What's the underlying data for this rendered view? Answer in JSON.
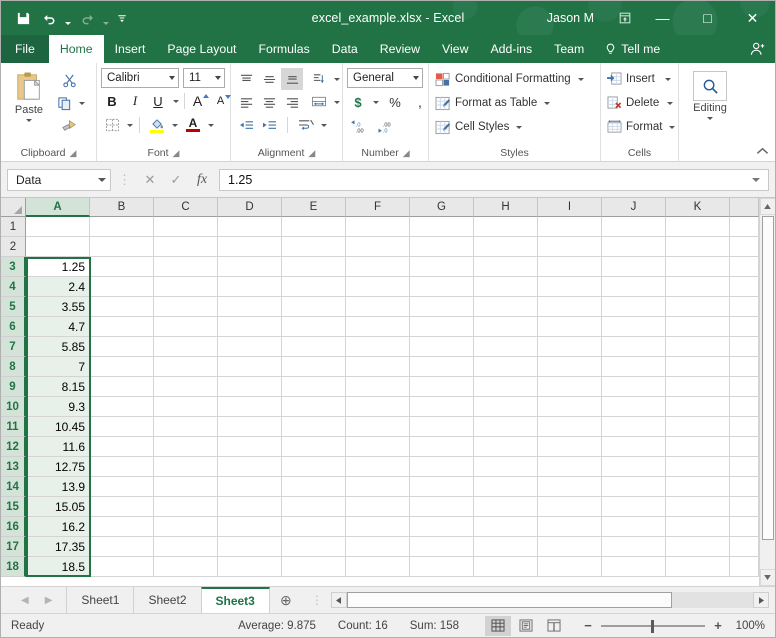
{
  "titlebar": {
    "document_title": "excel_example.xlsx  -  Excel",
    "user_name": "Jason M",
    "qat": [
      {
        "name": "save",
        "glyph": "💾",
        "label": "Save"
      },
      {
        "name": "undo",
        "glyph": "↶",
        "label": "Undo"
      },
      {
        "name": "redo",
        "glyph": "↷",
        "label": "Redo"
      },
      {
        "name": "customize",
        "glyph": "⩛",
        "label": "Customize Quick Access Toolbar"
      }
    ],
    "ribbon_display_options": "⤒",
    "minimize": "—",
    "maximize": "□",
    "close": "✕"
  },
  "tabs": [
    {
      "label": "File",
      "active": false
    },
    {
      "label": "Home",
      "active": true
    },
    {
      "label": "Insert",
      "active": false
    },
    {
      "label": "Page Layout",
      "active": false
    },
    {
      "label": "Formulas",
      "active": false
    },
    {
      "label": "Data",
      "active": false
    },
    {
      "label": "Review",
      "active": false
    },
    {
      "label": "View",
      "active": false
    },
    {
      "label": "Add-ins",
      "active": false
    },
    {
      "label": "Team",
      "active": false
    }
  ],
  "tell_me": "Tell me",
  "ribbon": {
    "clipboard": {
      "group_label": "Clipboard",
      "paste_label": "Paste",
      "cut_label": "Cut",
      "copy_label": "Copy",
      "format_painter_label": "Format Painter"
    },
    "font": {
      "group_label": "Font",
      "font_name": "Calibri",
      "font_size": "11",
      "bold": "B",
      "italic": "I",
      "underline": "U",
      "grow_font": "A",
      "shrink_font": "A",
      "borders_label": "Borders",
      "fill_color_label": "Fill Color",
      "font_color_label": "Font Color"
    },
    "alignment": {
      "group_label": "Alignment",
      "top_align": "Top Align",
      "middle_align": "Middle Align",
      "bottom_align": "Bottom Align",
      "orientation": "Orientation",
      "align_left": "Align Left",
      "center": "Center",
      "align_right": "Align Right",
      "merge_center": "Merge & Center",
      "decrease_indent": "Decrease Indent",
      "increase_indent": "Increase Indent",
      "wrap_text": "Wrap Text"
    },
    "number": {
      "group_label": "Number",
      "format": "General",
      "accounting": "$",
      "percent": "%",
      "comma": ",",
      "increase_decimal": "Increase Decimal",
      "decrease_decimal": "Decrease Decimal"
    },
    "styles": {
      "group_label": "Styles",
      "conditional_formatting": "Conditional Formatting",
      "format_as_table": "Format as Table",
      "cell_styles": "Cell Styles"
    },
    "cells": {
      "group_label": "Cells",
      "insert": "Insert",
      "delete": "Delete",
      "format": "Format"
    },
    "editing": {
      "group_label": "",
      "label": "Editing"
    },
    "collapse": "⌃"
  },
  "formula_bar": {
    "name_box": "Data",
    "cancel_icon": "✕",
    "enter_icon": "✓",
    "function_icon": "fx",
    "value": "1.25",
    "expand_icon": "⌄"
  },
  "grid": {
    "columns": [
      "A",
      "B",
      "C",
      "D",
      "E",
      "F",
      "G",
      "H",
      "I",
      "J",
      "K"
    ],
    "selected_column": "A",
    "rows": [
      {
        "num": "1",
        "a": ""
      },
      {
        "num": "2",
        "a": ""
      },
      {
        "num": "3",
        "a": "1.25"
      },
      {
        "num": "4",
        "a": "2.4"
      },
      {
        "num": "5",
        "a": "3.55"
      },
      {
        "num": "6",
        "a": "4.7"
      },
      {
        "num": "7",
        "a": "5.85"
      },
      {
        "num": "8",
        "a": "7"
      },
      {
        "num": "9",
        "a": "8.15"
      },
      {
        "num": "10",
        "a": "9.3"
      },
      {
        "num": "11",
        "a": "10.45"
      },
      {
        "num": "12",
        "a": "11.6"
      },
      {
        "num": "13",
        "a": "12.75"
      },
      {
        "num": "14",
        "a": "13.9"
      },
      {
        "num": "15",
        "a": "15.05"
      },
      {
        "num": "16",
        "a": "16.2"
      },
      {
        "num": "17",
        "a": "17.35"
      },
      {
        "num": "18",
        "a": "18.5"
      }
    ],
    "selection_start_row": "3",
    "selection_end_row": "18"
  },
  "sheet_tabs": {
    "first_icon": "◀",
    "prev_icon": "◀",
    "next_icon": "▶",
    "sheets": [
      {
        "label": "Sheet1",
        "active": false
      },
      {
        "label": "Sheet2",
        "active": false
      },
      {
        "label": "Sheet3",
        "active": true
      }
    ],
    "add_sheet": "⊕"
  },
  "hscroll": {
    "left_arrow": "◀",
    "right_arrow": "▶"
  },
  "vscroll": {
    "up_arrow": "▲",
    "down_arrow": "▼"
  },
  "status_bar": {
    "mode": "Ready",
    "average": "Average: 9.875",
    "count": "Count: 16",
    "sum": "Sum: 158",
    "views": [
      {
        "name": "normal-view",
        "glyph": "▦",
        "active": true
      },
      {
        "name": "page-layout-view",
        "glyph": "▣",
        "active": false
      },
      {
        "name": "page-break-view",
        "glyph": "▥",
        "active": false
      }
    ],
    "zoom_out": "−",
    "zoom_in": "+",
    "zoom_level": "100%"
  },
  "colors": {
    "excel_green": "#217346",
    "accent_selection": "#d3e3d8"
  }
}
